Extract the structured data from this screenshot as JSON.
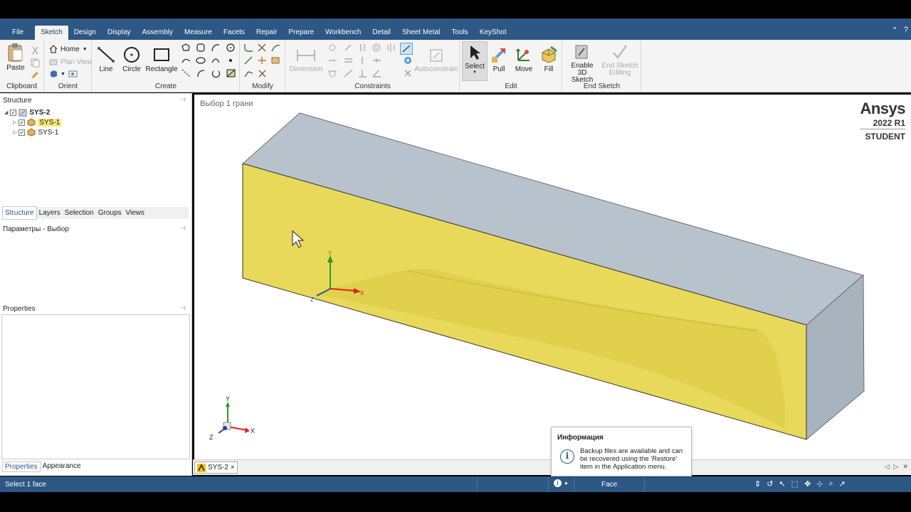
{
  "menu": {
    "file": "File",
    "tabs": [
      "Sketch",
      "Design",
      "Display",
      "Assembly",
      "Measure",
      "Facets",
      "Repair",
      "Prepare",
      "Workbench",
      "Detail",
      "Sheet Metal",
      "Tools",
      "KeyShot"
    ],
    "active": "Sketch"
  },
  "ribbon": {
    "clipboard": {
      "label": "Clipboard",
      "paste": "Paste"
    },
    "orient": {
      "label": "Orient",
      "home": "Home",
      "plan_view": "Plan View"
    },
    "create": {
      "label": "Create",
      "line": "Line",
      "circle": "Circle",
      "rectangle": "Rectangle"
    },
    "modify": {
      "label": "Modify"
    },
    "constraints": {
      "label": "Constraints",
      "dimension": "Dimension",
      "autoconstrain": "Autoconstrain"
    },
    "edit": {
      "label": "Edit",
      "select": "Select",
      "pull": "Pull",
      "move": "Move",
      "fill": "Fill"
    },
    "end_sketch": {
      "label": "End Sketch",
      "enable_3d_line1": "Enable 3D",
      "enable_3d_line2": "Sketch",
      "end_edit_line1": "End Sketch",
      "end_edit_line2": "Editing"
    }
  },
  "structure": {
    "title": "Structure",
    "root": "SYS-2",
    "children": [
      "SYS-1",
      "SYS-1"
    ]
  },
  "panel_tabs": [
    "Structure",
    "Layers",
    "Selection",
    "Groups",
    "Views"
  ],
  "options_title": "Параметры - Выбор",
  "properties_title": "Properties",
  "bottom_tabs": [
    "Properties",
    "Appearance"
  ],
  "viewport": {
    "selection_info": "Выбор 1 грани",
    "logo": {
      "brand": "Ansys",
      "version": "2022 R1",
      "edition": "STUDENT"
    },
    "axis_labels": {
      "x": "X",
      "y": "Y",
      "z": "Z"
    },
    "colors": {
      "selected_face": "#e8d95a",
      "top_face": "#b8c2cc",
      "end_face": "#a9b3bd"
    }
  },
  "doc_tab": {
    "label": "SYS-2",
    "close": "×"
  },
  "toast": {
    "title": "Информация",
    "message": "Backup files are available and can be recovered using the 'Restore' item in the Application menu."
  },
  "status": {
    "text": "Select 1 face",
    "mode": "Face"
  },
  "theme": {
    "accent": "#2d5784"
  }
}
